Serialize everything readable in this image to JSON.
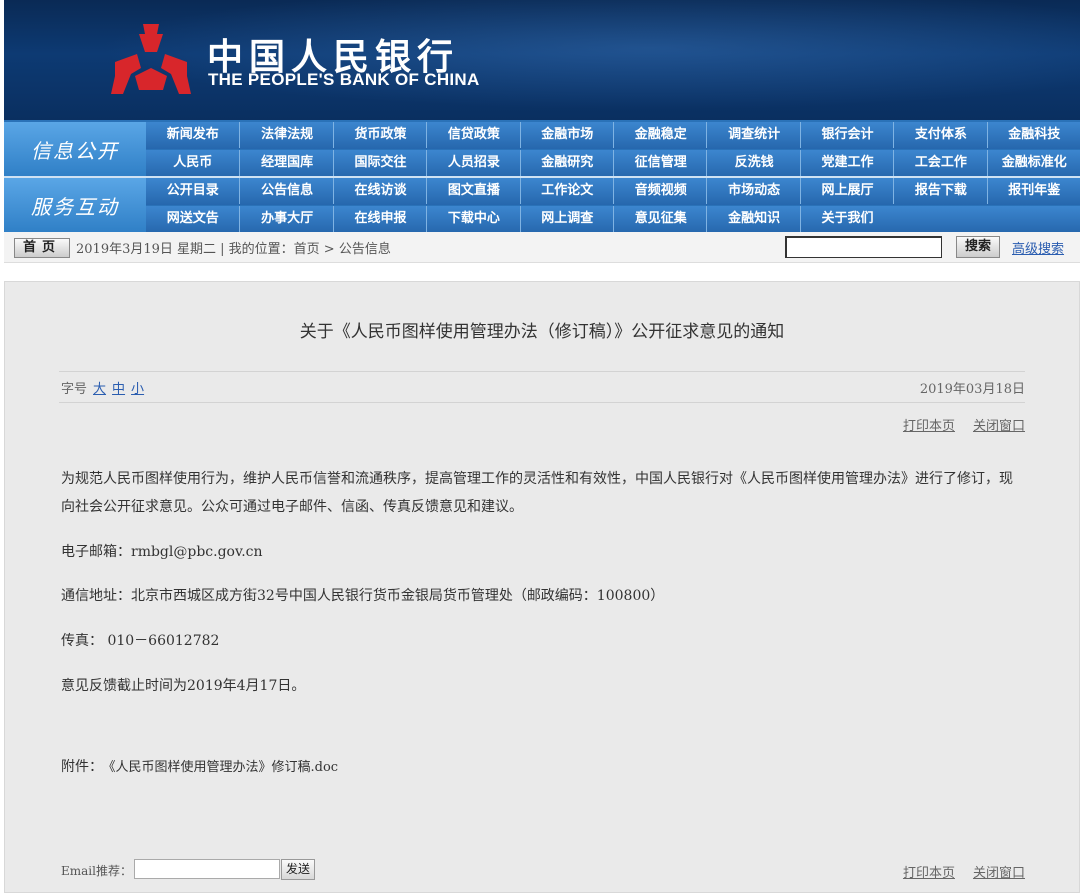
{
  "header": {
    "title_cn": "中国人民银行",
    "title_en": "THE PEOPLE'S BANK OF CHINA",
    "logo_icon": "pbc-logo-icon",
    "colors": {
      "banner": "#0d3a73",
      "nav": "#2a72b8",
      "logo_red": "#d8262b"
    }
  },
  "nav": {
    "info_title": "信息公开",
    "service_title": "服务互动",
    "info_row1": [
      "新闻发布",
      "法律法规",
      "货币政策",
      "信贷政策",
      "金融市场",
      "金融稳定",
      "调查统计",
      "银行会计",
      "支付体系",
      "金融科技"
    ],
    "info_row2": [
      "人民币",
      "经理国库",
      "国际交往",
      "人员招录",
      "金融研究",
      "征信管理",
      "反洗钱",
      "党建工作",
      "工会工作",
      "金融标准化"
    ],
    "service_row1": [
      "公开目录",
      "公告信息",
      "在线访谈",
      "图文直播",
      "工作论文",
      "音频视频",
      "市场动态",
      "网上展厅",
      "报告下载",
      "报刊年鉴"
    ],
    "service_row2": [
      "网送文告",
      "办事大厅",
      "在线申报",
      "下载中心",
      "网上调查",
      "意见征集",
      "金融知识",
      "关于我们"
    ]
  },
  "locbar": {
    "home": "首页",
    "date": "2019年3月19日 星期二 | 我的位置：首页 > 公告信息",
    "search_btn": "搜索",
    "adv_search": "高级搜索"
  },
  "article": {
    "title": "关于《人民币图样使用管理办法（修订稿）》公开征求意见的通知",
    "fontsize_label": "字号",
    "fontsize_options": [
      "大",
      "中",
      "小"
    ],
    "pub_date": "2019年03月18日",
    "print": "打印本页",
    "close": "关闭窗口",
    "para1": "为规范人民币图样使用行为，维护人民币信誉和流通秩序，提高管理工作的灵活性和有效性，中国人民银行对《人民币图样使用管理办法》进行了修订，现向社会公开征求意见。公众可通过电子邮件、信函、传真反馈意见和建议。",
    "email": "电子邮箱：rmbgl@pbc.gov.cn",
    "address": "通信地址：北京市西城区成方街32号中国人民银行货币金银局货币管理处（邮政编码：100800）",
    "fax": "传真：  010－66012782",
    "deadline": "意见反馈截止时间为2019年4月17日。",
    "attach_label": "附件：",
    "attach_file": "《人民币图样使用管理办法》修订稿.doc",
    "email_recommend": "Email推荐：",
    "send": "发送"
  }
}
